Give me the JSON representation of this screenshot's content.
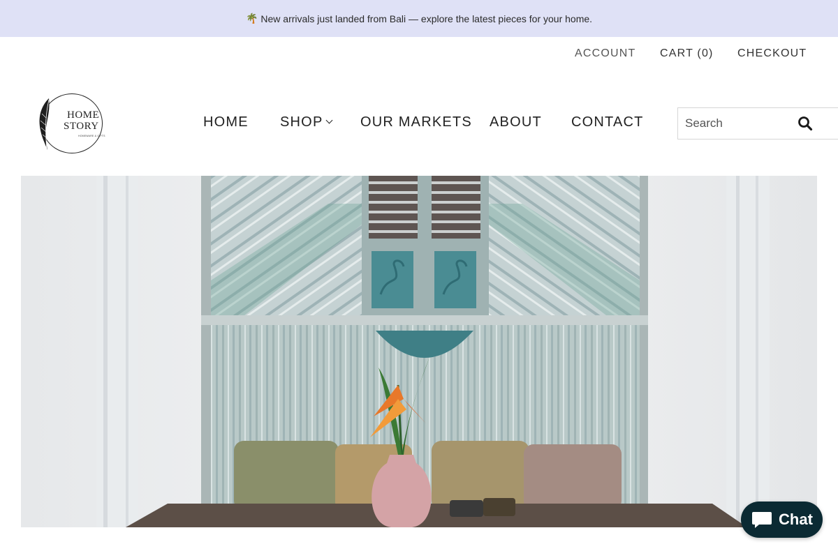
{
  "announcement": {
    "text": "New arrivals just landed from Bali — explore the latest pieces for your home.",
    "icon": "palm-tree-icon"
  },
  "utility_nav": {
    "account": "ACCOUNT",
    "cart": "CART (0)",
    "checkout": "CHECKOUT"
  },
  "logo": {
    "line1": "HOME",
    "line2": "STORY",
    "tagline": "HOMEWARE & GIFTS"
  },
  "main_nav": {
    "items": [
      {
        "label": "HOME"
      },
      {
        "label": "SHOP"
      },
      {
        "label": "OUR MARKETS"
      },
      {
        "label": "ABOUT"
      },
      {
        "label": "CONTACT"
      }
    ]
  },
  "search": {
    "placeholder": "Search",
    "icon": "search-icon"
  },
  "hero": {
    "image": "hero-image"
  },
  "chat": {
    "label": "Chat",
    "icon": "chat-bubble-icon"
  },
  "colors": {
    "announcement_bg": "#dfe1f6",
    "chat_bg": "#0b2a33",
    "text": "#222222"
  }
}
